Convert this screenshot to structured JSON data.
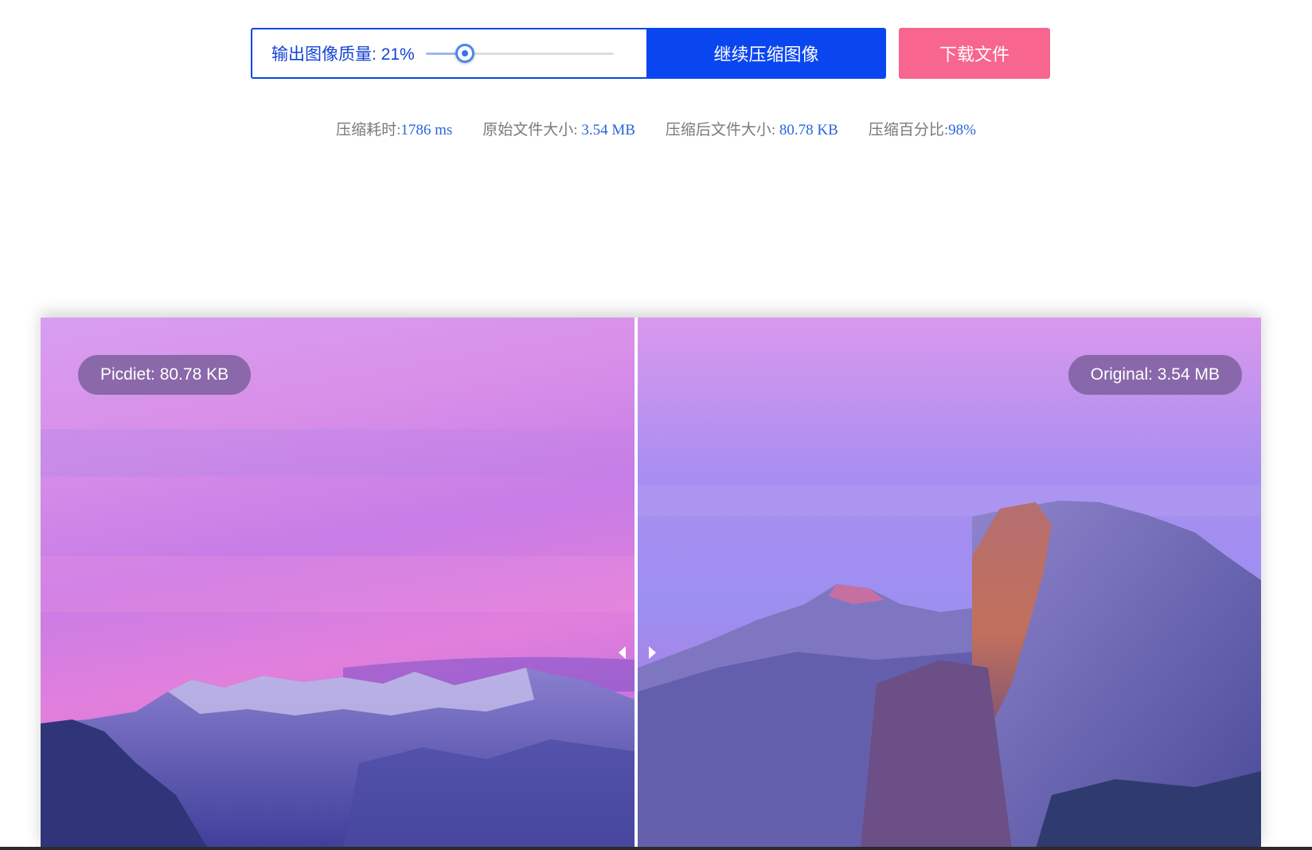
{
  "toolbar": {
    "quality_label": "输出图像质量: 21%",
    "quality_value": 0.21,
    "continue_label": "继续压缩图像",
    "download_label": "下载文件"
  },
  "stats": {
    "time_label": "压缩耗时:",
    "time_value": "1786 ms",
    "original_label": "原始文件大小: ",
    "original_value": "3.54 MB",
    "compressed_label": "压缩后文件大小: ",
    "compressed_value": "80.78 KB",
    "ratio_label": "压缩百分比:",
    "ratio_value": "98%"
  },
  "compare": {
    "left_badge": "Picdiet: 80.78 KB",
    "right_badge": "Original: 3.54 MB"
  },
  "colors": {
    "primary": "#0a46f0",
    "download": "#f8658e",
    "stat_value": "#2a66d8"
  }
}
